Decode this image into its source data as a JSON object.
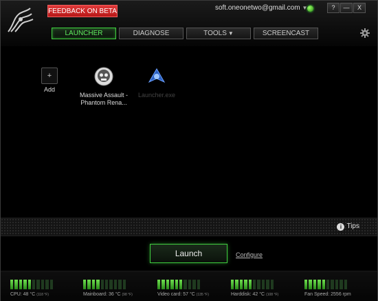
{
  "header": {
    "feedback_label": "FEEDBACK ON BETA",
    "account_email": "soft.oneonetwo@gmail.com",
    "window_buttons": [
      "?",
      "—",
      "X"
    ]
  },
  "tabs": [
    {
      "label": "LAUNCHER",
      "active": true
    },
    {
      "label": "DIAGNOSE",
      "active": false
    },
    {
      "label": "TOOLS",
      "active": false,
      "has_dropdown": true
    },
    {
      "label": "SCREENCAST",
      "active": false
    }
  ],
  "apps": [
    {
      "label": "Add",
      "icon": "plus-icon"
    },
    {
      "label_line1": "Massive Assault -",
      "label_line2": "Phantom Rena...",
      "icon": "skull-game-icon"
    },
    {
      "label": "Launcher.exe",
      "icon": "launcher-icon"
    }
  ],
  "tips_label": "Tips",
  "launch_label": "Launch",
  "configure_label": "Configure",
  "sensors": [
    {
      "label": "CPU: 48 °C",
      "sub": "(118 °F)",
      "level": 0.5
    },
    {
      "label": "Mainboard: 36 °C",
      "sub": "(98 °F)",
      "level": 0.4
    },
    {
      "label": "Video card: 57 °C",
      "sub": "(135 °F)",
      "level": 0.6
    },
    {
      "label": "Harddisk: 42 °C",
      "sub": "(108 °F)",
      "level": 0.45
    },
    {
      "label": "Fan Speed: 2556 rpm",
      "sub": "",
      "level": 0.5
    }
  ],
  "colors": {
    "accent": "#3fcf3f",
    "feedback": "#d42a2a"
  }
}
